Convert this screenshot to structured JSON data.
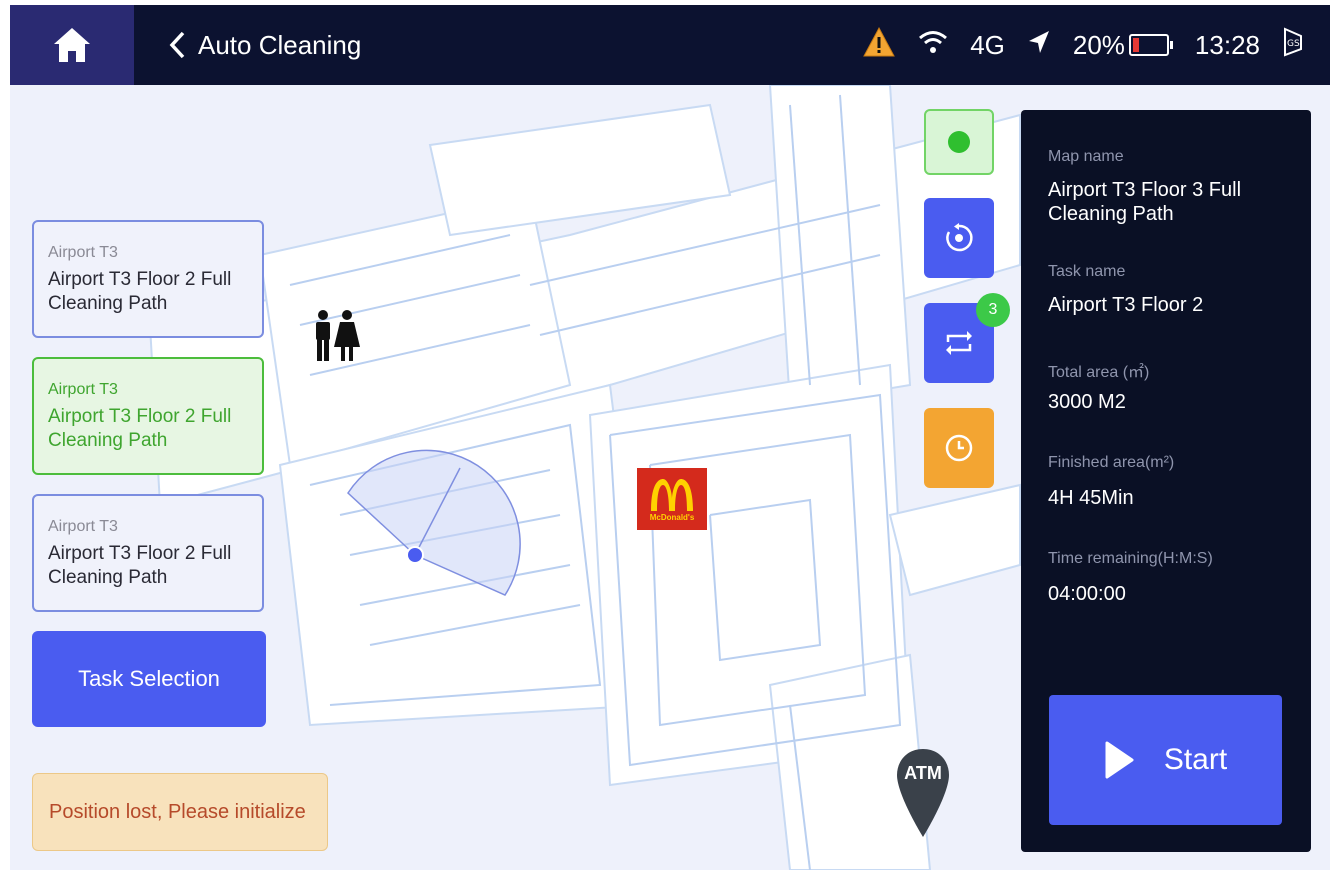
{
  "topbar": {
    "title": "Auto Cleaning",
    "network": "4G",
    "battery": "20%",
    "time": "13:28"
  },
  "tasks": [
    {
      "sub": "Airport T3",
      "main": "Airport T3 Floor 2 Full Cleaning Path",
      "selected": false
    },
    {
      "sub": "Airport T3",
      "main": "Airport T3 Floor 2 Full Cleaning Path",
      "selected": true
    },
    {
      "sub": "Airport T3",
      "main": "Airport T3 Floor 2 Full Cleaning Path",
      "selected": false
    }
  ],
  "task_selection_label": "Task Selection",
  "alert_text": "Position lost, Please initialize",
  "loop_badge": "3",
  "info": {
    "map_label": "Map name",
    "map_value": "Airport T3 Floor 3 Full Cleaning Path",
    "task_label": "Task name",
    "task_value": "Airport T3 Floor 2",
    "total_label": "Total area (㎡)",
    "total_value": "3000 M2",
    "finished_label": "Finished area(m²)",
    "finished_value": "4H 45Min",
    "remaining_label": "Time remaining(H:M:S)",
    "remaining_value": "04:00:00"
  },
  "start_label": "Start",
  "map": {
    "poi_atm": "ATM",
    "poi_mcd": "McDonald's"
  },
  "colors": {
    "accent": "#4a5cf0",
    "selected": "#4cbd3c",
    "warning": "#f3a532",
    "topbar": "#0c1230",
    "panel": "#0a1025"
  }
}
